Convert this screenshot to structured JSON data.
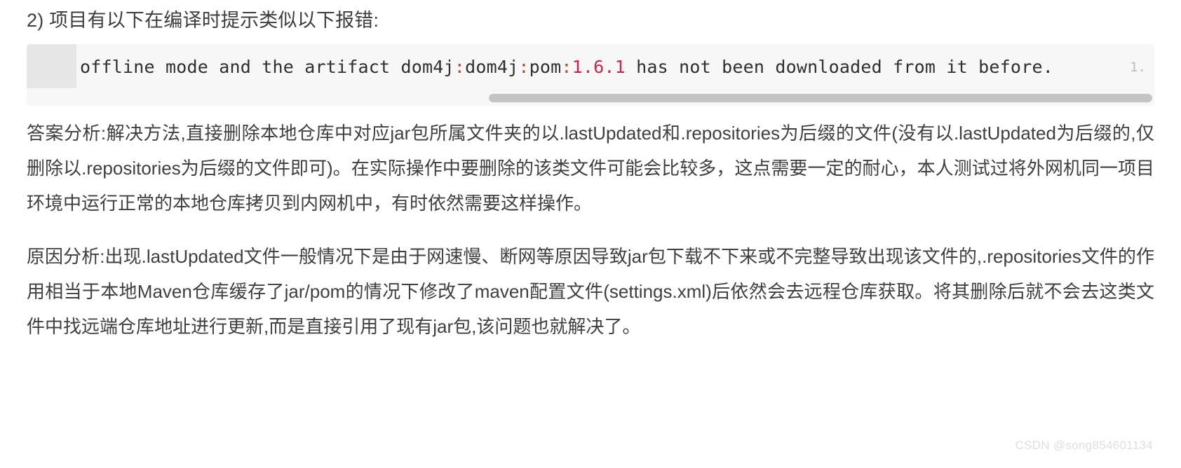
{
  "heading": {
    "text": "2) 项目有以下在编译时提示类似以下报错:"
  },
  "code_block": {
    "line_number": "1.",
    "segments": {
      "before_colon": "offline mode and the artifact dom4j",
      "colon1": ":",
      "artifact": "dom4j",
      "colon2": ":",
      "packaging": "pom",
      "colon3": ":",
      "version": "1.6.1",
      "tail": " has not been downloaded from it before."
    },
    "full_text": "offline mode and the artifact dom4j:dom4j:pom:1.6.1 has not been downloaded from it before.",
    "colors": {
      "background": "#f7f7f7",
      "gutter": "#e7e7e7",
      "line_number": "#b9bcbe",
      "text": "#2f2f2f",
      "punctuation": "#a0522d",
      "version_number": "#c7254e",
      "scrollbar_thumb": "#c4c4c4"
    }
  },
  "paragraphs": [
    {
      "id": "answer-analysis",
      "text": "答案分析:解决方法,直接删除本地仓库中对应jar包所属文件夹的以.lastUpdated和.repositories为后缀的文件(没有以.lastUpdated为后缀的,仅删除以.repositories为后缀的文件即可)。在实际操作中要删除的该类文件可能会比较多，这点需要一定的耐心，本人测试过将外网机同一项目环境中运行正常的本地仓库拷贝到内网机中，有时依然需要这样操作。"
    },
    {
      "id": "cause-analysis",
      "text": "原因分析:出现.lastUpdated文件一般情况下是由于网速慢、断网等原因导致jar包下载不下来或不完整导致出现该文件的,.repositories文件的作用相当于本地Maven仓库缓存了jar/pom的情况下修改了maven配置文件(settings.xml)后依然会去远程仓库获取。将其删除后就不会去这类文件中找远端仓库地址进行更新,而是直接引用了现有jar包,该问题也就解决了。"
    }
  ],
  "watermark": {
    "text": "CSDN @song854601134"
  }
}
